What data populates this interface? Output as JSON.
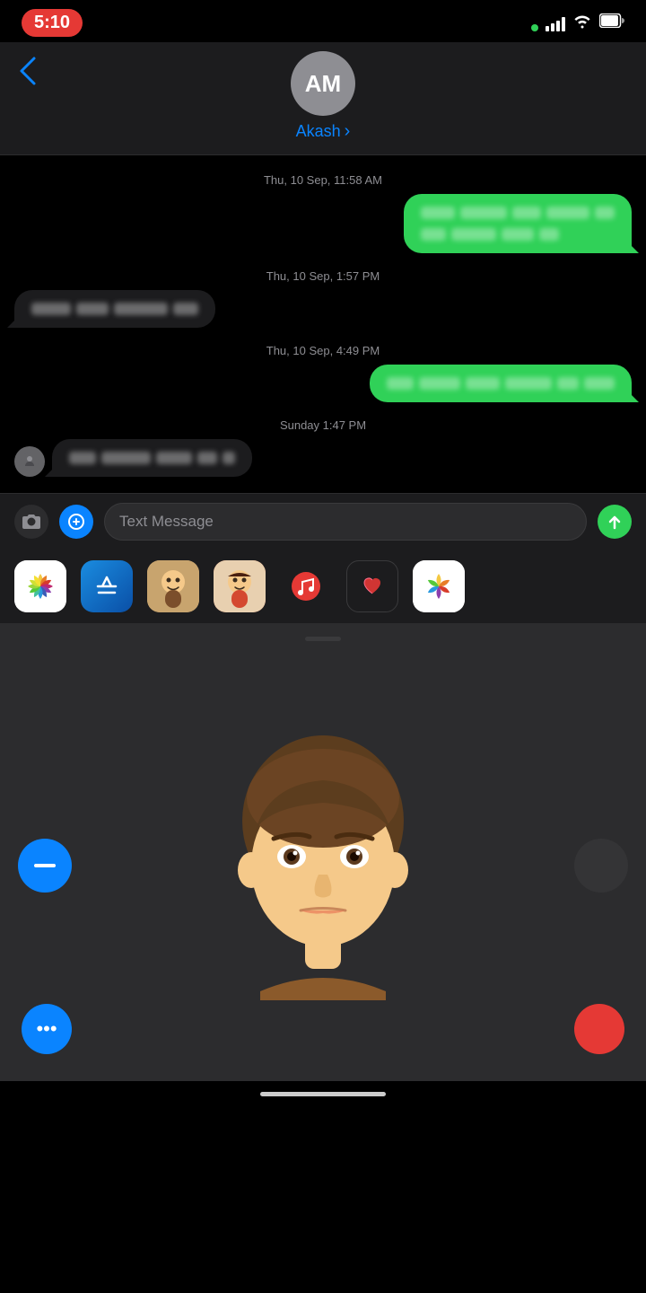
{
  "status_bar": {
    "time": "5:10",
    "signal_label": "signal",
    "wifi_label": "wifi",
    "battery_label": "battery"
  },
  "header": {
    "back_label": "‹",
    "avatar_initials": "AM",
    "contact_name": "Akash"
  },
  "messages": [
    {
      "type": "timestamp",
      "text": "Thu, 10 Sep, 11:58 AM"
    },
    {
      "type": "sent",
      "id": "msg1"
    },
    {
      "type": "timestamp",
      "text": "Thu, 10 Sep, 1:57 PM"
    },
    {
      "type": "received",
      "id": "msg2"
    },
    {
      "type": "timestamp",
      "text": "Thu, 10 Sep, 4:49 PM"
    },
    {
      "type": "sent",
      "id": "msg3"
    },
    {
      "type": "timestamp",
      "text": "Sunday 1:47 PM"
    },
    {
      "type": "received_avatar",
      "id": "msg4"
    }
  ],
  "input_bar": {
    "camera_label": "camera",
    "appstore_label": "App Store",
    "placeholder": "Text Message",
    "send_label": "send"
  },
  "app_icons": [
    {
      "name": "Photos",
      "color": "#fff",
      "bg": "#fff"
    },
    {
      "name": "App Store",
      "color": "#0a84ff",
      "bg": "#0a84ff"
    },
    {
      "name": "Memoji 1",
      "color": "#c8a46e",
      "bg": "#c8a46e"
    },
    {
      "name": "Memoji 2",
      "color": "#d45b3c",
      "bg": "#d45b3c"
    },
    {
      "name": "Music",
      "color": "#e53935",
      "bg": "#e53935"
    },
    {
      "name": "App 6",
      "color": "#1c1c1e",
      "bg": "#1c1c1e"
    },
    {
      "name": "Photos2",
      "color": "#fff",
      "bg": "#fff"
    }
  ],
  "memoji": {
    "dots_btn_label": "•••",
    "record_btn_label": "record"
  }
}
